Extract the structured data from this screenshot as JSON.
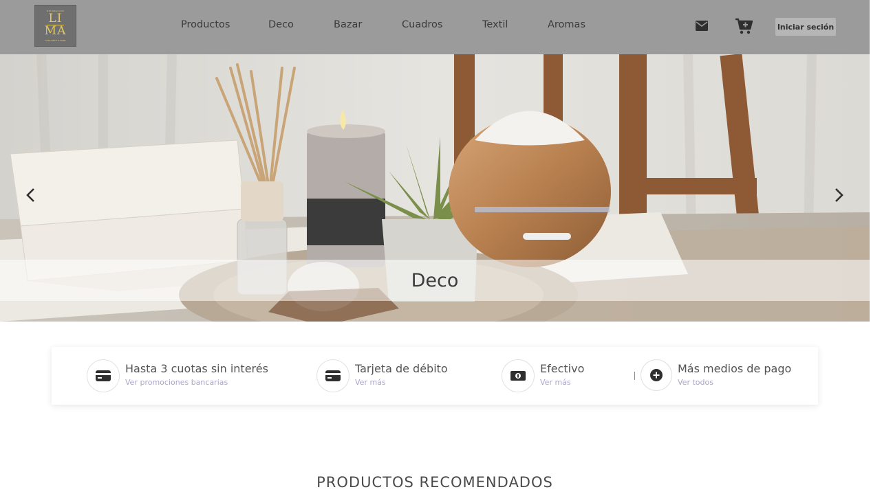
{
  "brand": {
    "logo_top": "DECORACION",
    "logo_line1": "LI",
    "logo_line2": "MA",
    "logo_tag": "CASA DECO & ROPA"
  },
  "nav": {
    "items": [
      {
        "label": "Productos"
      },
      {
        "label": "Deco"
      },
      {
        "label": "Bazar"
      },
      {
        "label": "Cuadros"
      },
      {
        "label": "Textil"
      },
      {
        "label": "Aromas"
      }
    ]
  },
  "header_actions": {
    "mail_icon": "envelope-icon",
    "cart_icon": "cart-plus-icon",
    "login_label": "Iniciar seción"
  },
  "hero": {
    "caption": "Deco",
    "prev_icon": "chevron-left-icon",
    "next_icon": "chevron-right-icon"
  },
  "payments": [
    {
      "icon": "credit-card-icon",
      "title": "Hasta 3 cuotas sin interés",
      "link": "Ver promociones bancarias"
    },
    {
      "icon": "debit-card-icon",
      "title": "Tarjeta de débito",
      "link": "Ver más"
    },
    {
      "icon": "cash-icon",
      "title": "Efectivo",
      "link": "Ver más"
    },
    {
      "icon": "plus-circle-icon",
      "title": "Más medios de pago",
      "link": "Ver todos"
    }
  ],
  "recommended": {
    "title": "PRODUCTOS RECOMENDADOS"
  },
  "colors": {
    "header_bg": "#9b9b9b",
    "link_purple": "#a9a6c9",
    "logo_gold": "#e2c863"
  }
}
